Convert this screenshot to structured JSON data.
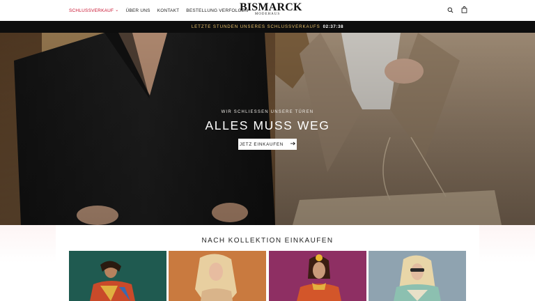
{
  "header": {
    "nav": [
      {
        "label": "SCHLUSSVERKAUF",
        "active": true,
        "dropdown": true
      },
      {
        "label": "ÜBER UNS"
      },
      {
        "label": "KONTAKT"
      },
      {
        "label": "BESTELLUNG VERFOLGEN"
      }
    ],
    "logo": {
      "main": "BISMARCK",
      "sub": "MODEHAUS"
    },
    "icons": [
      "search-icon",
      "bag-icon"
    ]
  },
  "announcement": {
    "text": "LETZTE STUNDEN UNSERES SCHLUSSVERKAUFS",
    "timer": "02:37:38"
  },
  "hero": {
    "eyebrow": "WIR SCHLIESSEN UNSERE TÜREN",
    "title": "ALLES MUSS WEG",
    "cta_label": "JETZ EINKAUFEN"
  },
  "collections": {
    "title": "NACH KOLLEKTION EINKAUFEN",
    "cards": [
      {
        "name": "collection-card-1",
        "bg": "#1f5a50"
      },
      {
        "name": "collection-card-2",
        "bg": "#c97a3f"
      },
      {
        "name": "collection-card-3",
        "bg": "#8e2f63"
      },
      {
        "name": "collection-card-4",
        "bg": "#8fa3b0"
      }
    ]
  },
  "colors": {
    "accent_red": "#c8102e",
    "announcement_gold": "#e8c06a",
    "announcement_bg": "#0d0d0d"
  }
}
